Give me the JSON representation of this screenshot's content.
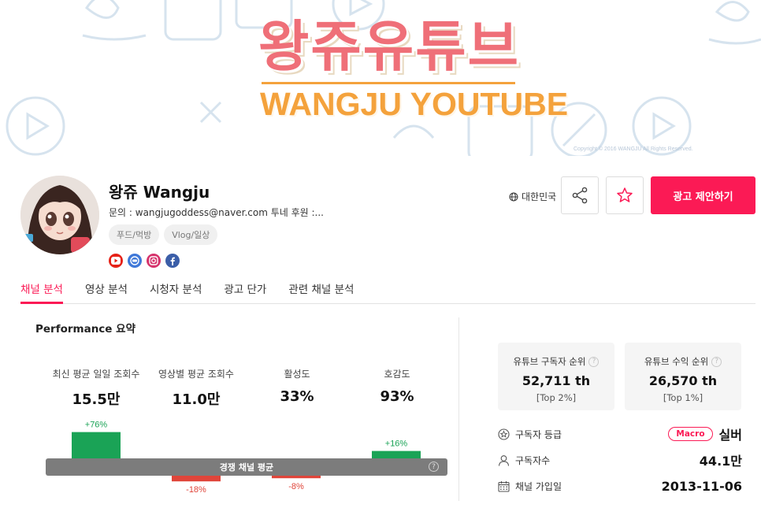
{
  "banner": {
    "title_ko": "왕쥬유튜브",
    "title_en": "WANGJU YOUTUBE",
    "copyright": "Copyright © 2016 WANGJU All Rights Reserved."
  },
  "channel": {
    "name": "왕쥬 Wangju",
    "contact": "문의 : wangjugoddess@naver.com 투네 후원 :...",
    "tags": [
      "푸드/먹방",
      "Vlog/일상"
    ],
    "socials": [
      "youtube-icon",
      "blog-icon",
      "instagram-icon",
      "facebook-icon"
    ],
    "country": "대한민국"
  },
  "actions": {
    "ad_proposal": "광고 제안하기"
  },
  "tabs": [
    "채널 분석",
    "영상 분석",
    "시청자 분석",
    "광고 단가",
    "관련 채널 분석"
  ],
  "performance": {
    "title": "Performance 요약",
    "metrics": [
      {
        "label": "최신 평균 일일 조회수",
        "value": "15.5만",
        "delta": "+76%",
        "delta_value": 76
      },
      {
        "label": "영상별 평균 조회수",
        "value": "11.0만",
        "delta": "-18%",
        "delta_value": -18
      },
      {
        "label": "활성도",
        "value": "33%",
        "delta": "-8%",
        "delta_value": -8
      },
      {
        "label": "호감도",
        "value": "93%",
        "delta": "+16%",
        "delta_value": 16
      }
    ],
    "baseline_label": "경쟁 채널 평균",
    "colors": {
      "positive": "#1aa356",
      "negative": "#e0453a"
    }
  },
  "ranks": {
    "subscriber_rank": {
      "label": "유튜브 구독자 순위",
      "value": "52,711 th",
      "top": "[Top 2%]"
    },
    "revenue_rank": {
      "label": "유튜브 수익 순위",
      "value": "26,570 th",
      "top": "[Top 1%]"
    }
  },
  "info": {
    "grade_label": "구독자 등급",
    "grade_badge": "Macro",
    "grade_value": "실버",
    "subscribers_label": "구독자수",
    "subscribers_value": "44.1만",
    "joined_label": "채널 가입일",
    "joined_value": "2013-11-06"
  },
  "help_glyph": "?"
}
